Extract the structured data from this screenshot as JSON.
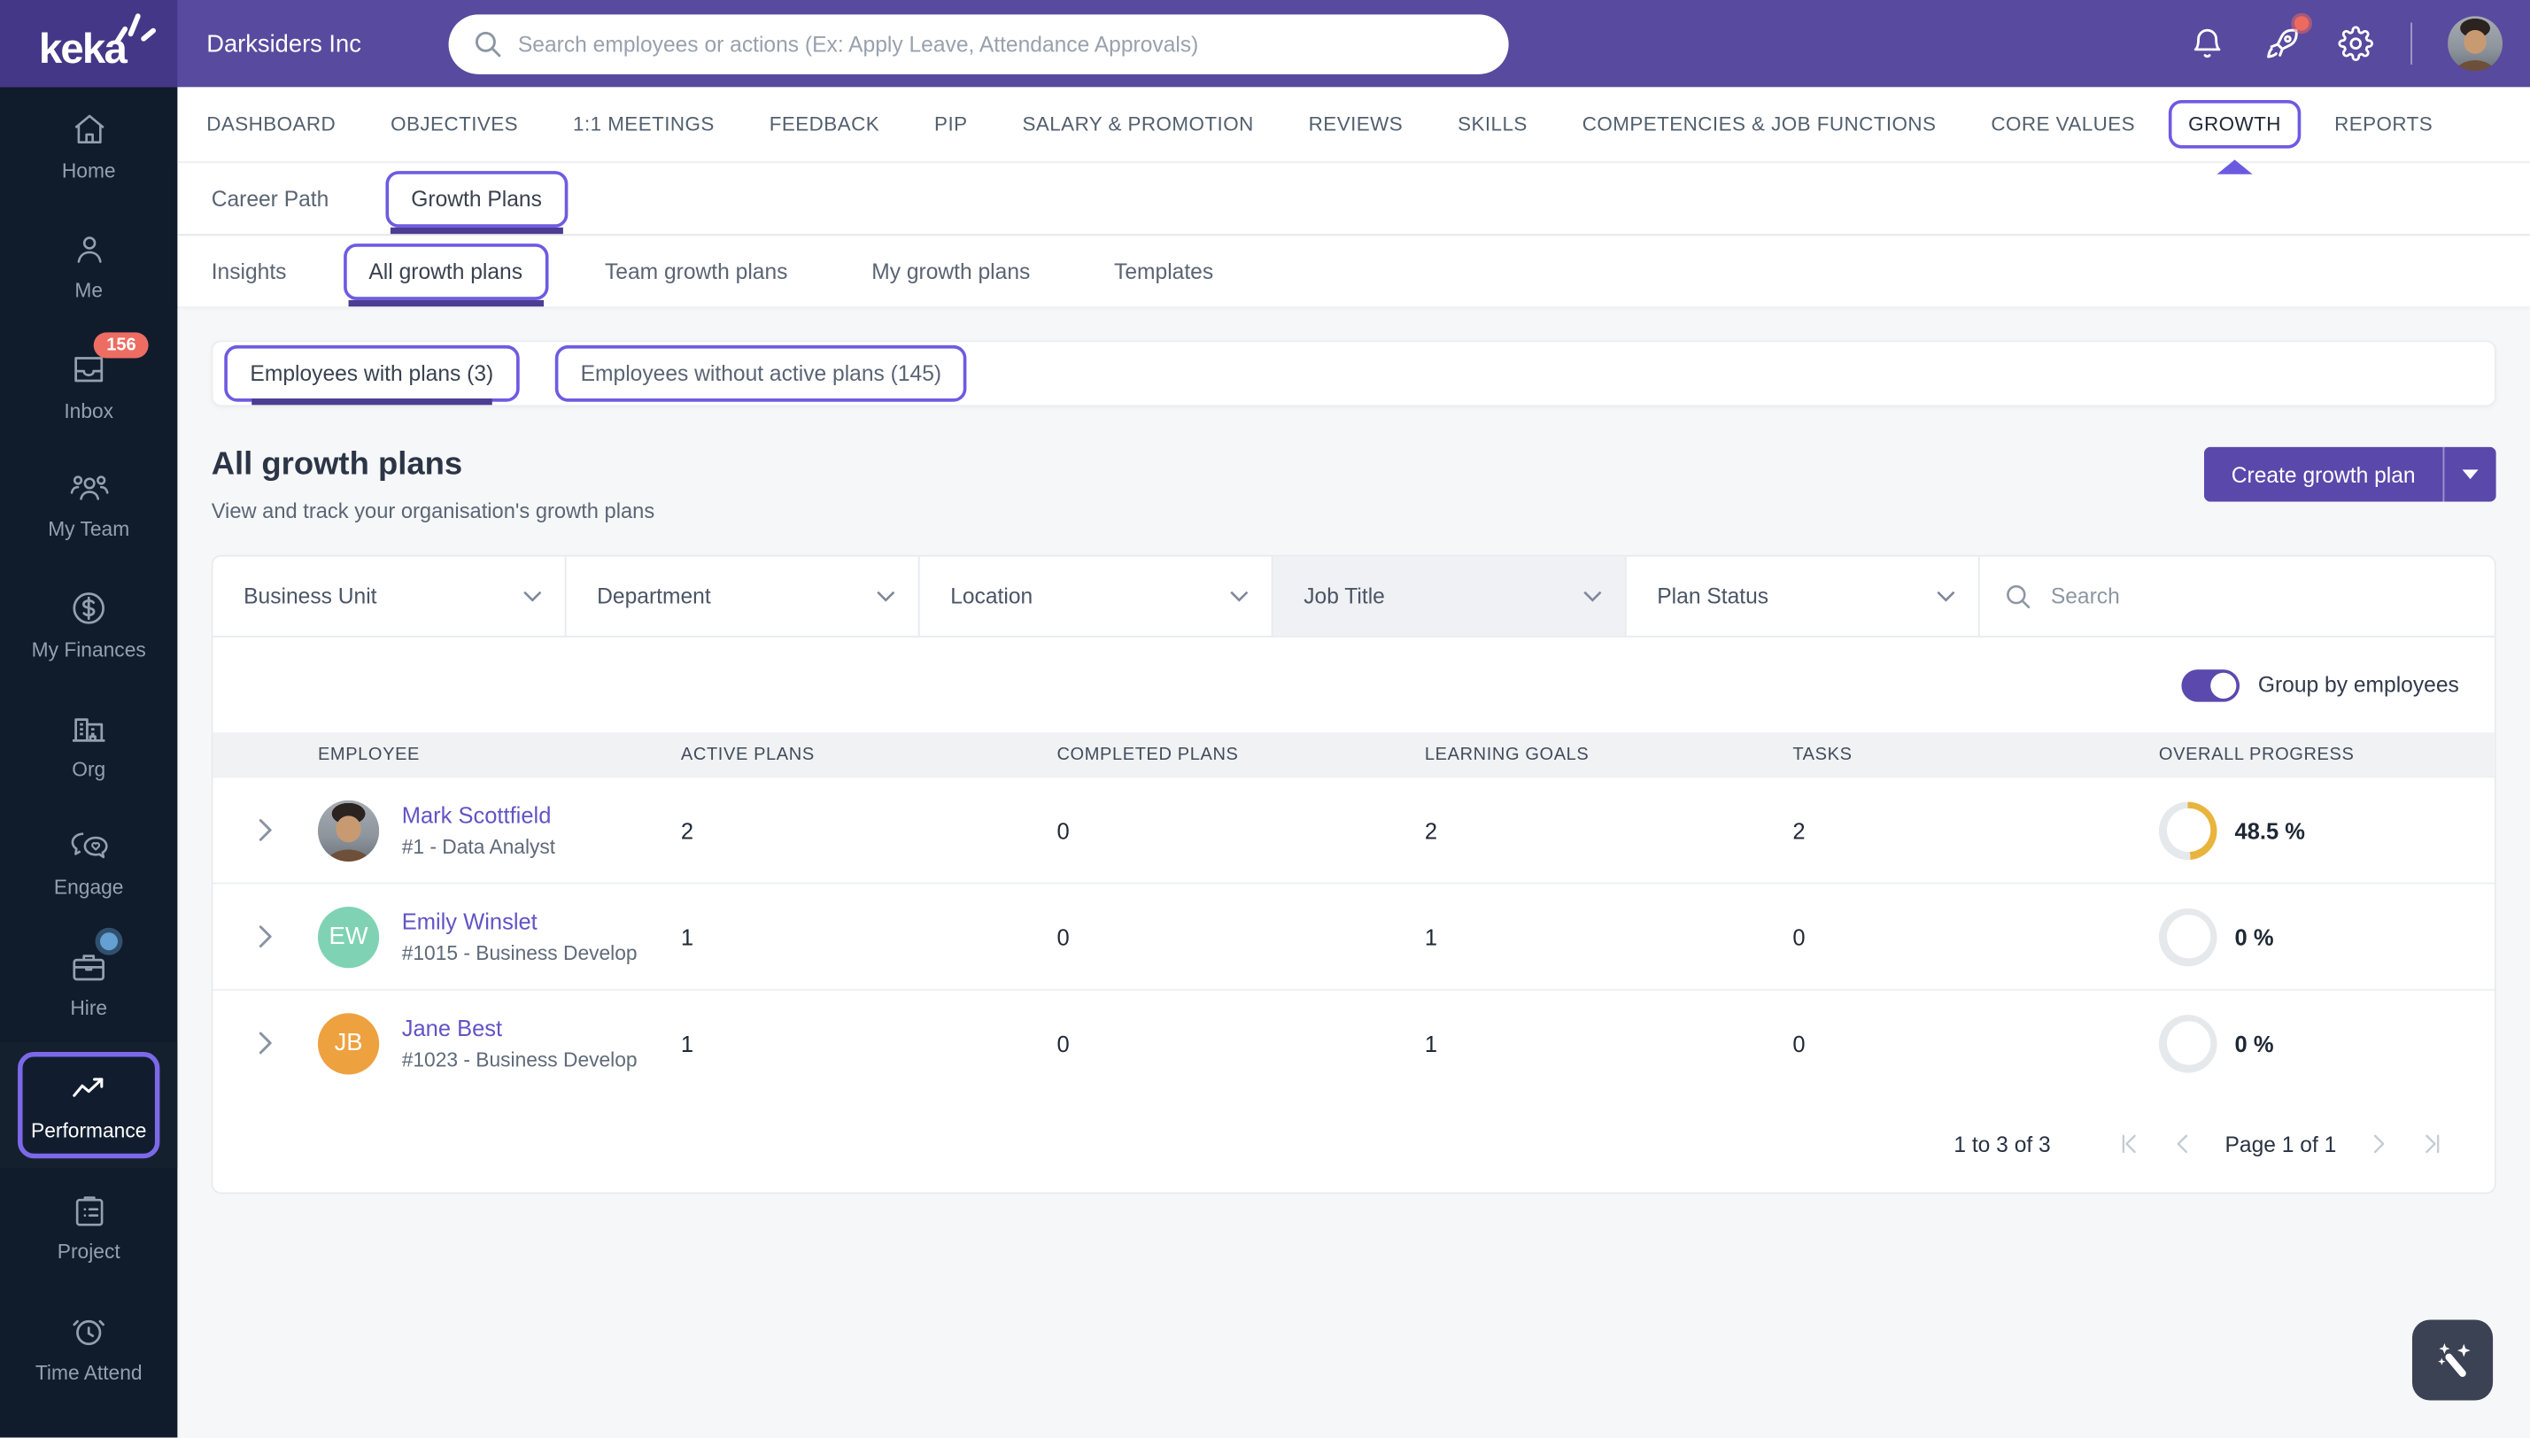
{
  "brand": {
    "logo": "keka",
    "company": "Darksiders Inc"
  },
  "topbar": {
    "search_placeholder": "Search employees or actions (Ex: Apply Leave, Attendance Approvals)"
  },
  "sidebar": {
    "items": [
      {
        "label": "Home"
      },
      {
        "label": "Me"
      },
      {
        "label": "Inbox",
        "badge": "156"
      },
      {
        "label": "My Team"
      },
      {
        "label": "My Finances"
      },
      {
        "label": "Org"
      },
      {
        "label": "Engage"
      },
      {
        "label": "Hire"
      },
      {
        "label": "Performance",
        "active": true
      },
      {
        "label": "Project"
      },
      {
        "label": "Time Attend"
      }
    ]
  },
  "nav": {
    "tabs": [
      "DASHBOARD",
      "OBJECTIVES",
      "1:1 MEETINGS",
      "FEEDBACK",
      "PIP",
      "SALARY & PROMOTION",
      "REVIEWS",
      "SKILLS",
      "COMPETENCIES & JOB FUNCTIONS",
      "CORE VALUES",
      "GROWTH",
      "REPORTS"
    ],
    "active": "GROWTH"
  },
  "subnav": {
    "tabs": [
      "Career Path",
      "Growth Plans"
    ],
    "active": "Growth Plans"
  },
  "sectionnav": {
    "tabs": [
      "Insights",
      "All growth plans",
      "Team growth plans",
      "My growth plans",
      "Templates"
    ],
    "active": "All growth plans"
  },
  "view_tabs": {
    "with_plans": "Employees with plans (3)",
    "without_plans": "Employees without active plans (145)"
  },
  "page": {
    "title": "All growth plans",
    "subtitle": "View and track your organisation's growth plans",
    "create_button": "Create growth plan"
  },
  "filters": {
    "business_unit": "Business Unit",
    "department": "Department",
    "location": "Location",
    "job_title": "Job Title",
    "plan_status": "Plan Status",
    "search_placeholder": "Search"
  },
  "toggle": {
    "label": "Group by employees",
    "on": true
  },
  "table": {
    "columns": [
      "EMPLOYEE",
      "ACTIVE PLANS",
      "COMPLETED PLANS",
      "LEARNING GOALS",
      "TASKS",
      "OVERALL PROGRESS"
    ],
    "rows": [
      {
        "name": "Mark Scottfield",
        "detail": "#1 - Data Analyst",
        "avatar": "photo",
        "active_plans": "2",
        "completed_plans": "0",
        "learning_goals": "2",
        "tasks": "2",
        "progress": 48.5,
        "progress_label": "48.5 %"
      },
      {
        "name": "Emily Winslet",
        "detail": "#1015 - Business Develop",
        "initials": "EW",
        "avatar_color": "#7fd3b4",
        "active_plans": "1",
        "completed_plans": "0",
        "learning_goals": "1",
        "tasks": "0",
        "progress": 0,
        "progress_label": "0 %"
      },
      {
        "name": "Jane Best",
        "detail": "#1023 - Business Develop",
        "initials": "JB",
        "avatar_color": "#eea13f",
        "active_plans": "1",
        "completed_plans": "0",
        "learning_goals": "1",
        "tasks": "0",
        "progress": 0,
        "progress_label": "0 %"
      }
    ]
  },
  "pagination": {
    "range": "1 to 3 of 3",
    "page": "Page 1 of 1"
  },
  "colors": {
    "accent": "#6d5be2",
    "topbar": "#584a9e",
    "logo_block": "#453787",
    "sidebar": "#101b2c",
    "underline": "#4c3c92",
    "create_button": "#5a48ab",
    "progress_arc": "#e9b43d",
    "badge_red": "#ed6d63"
  }
}
